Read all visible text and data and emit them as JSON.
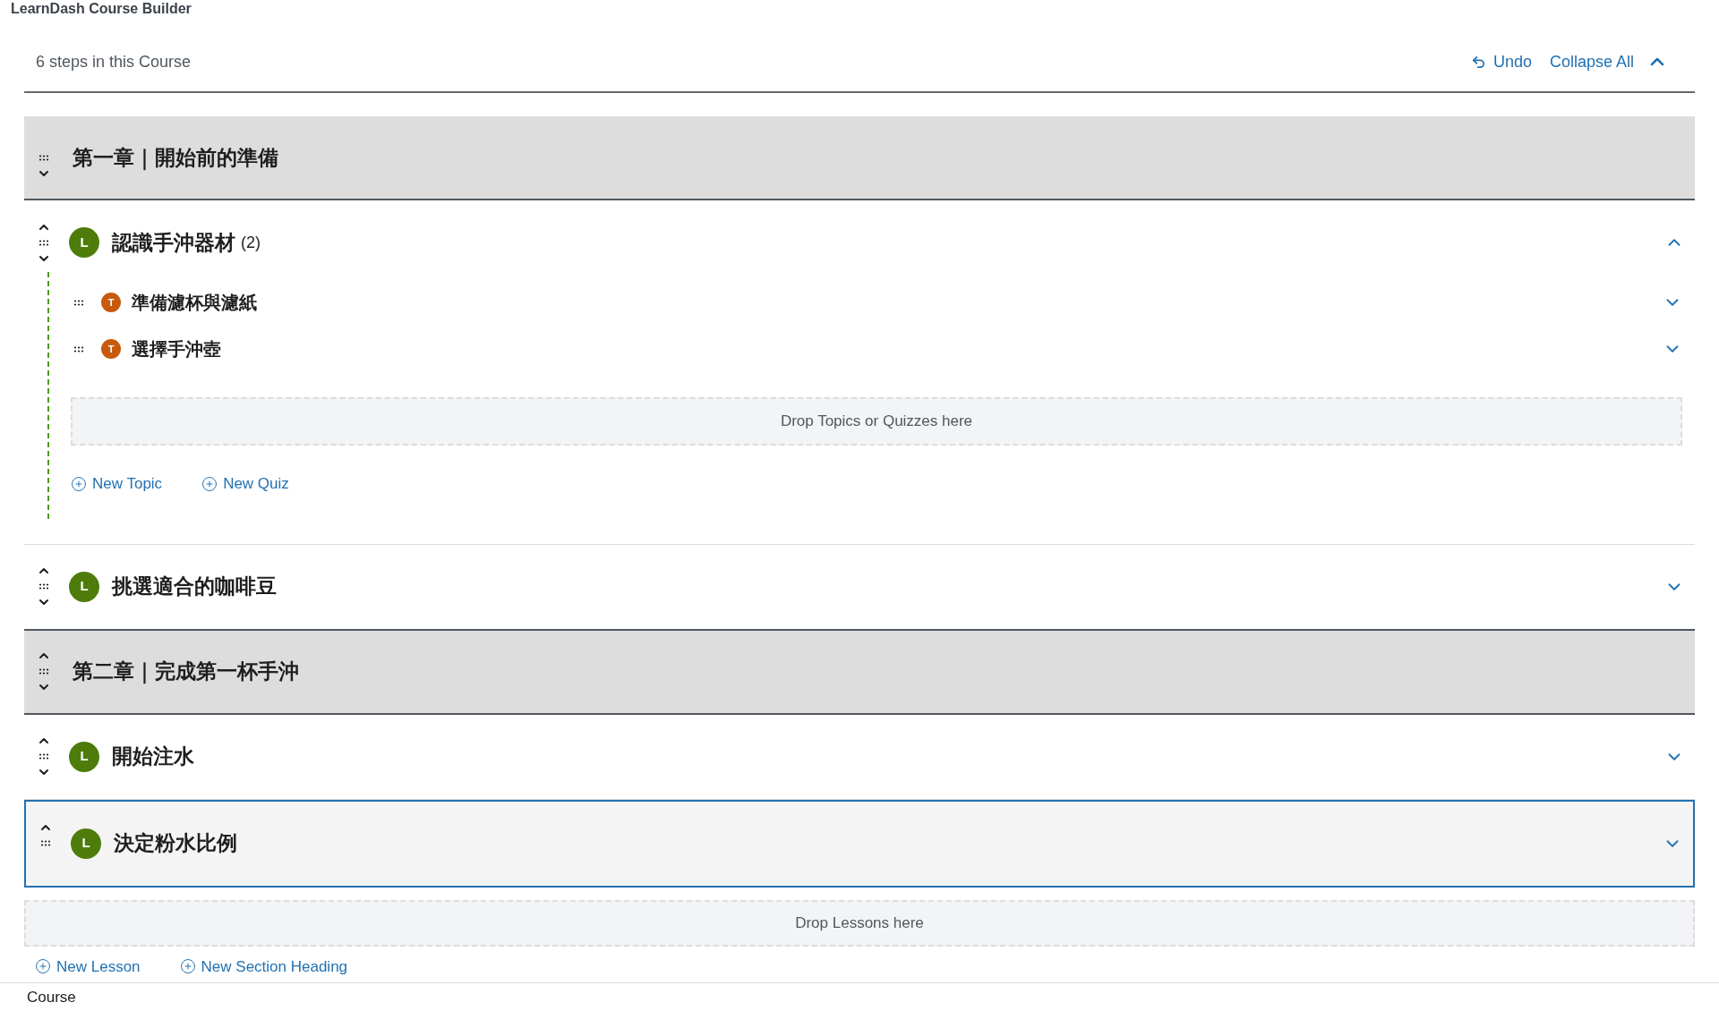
{
  "page_title": "LearnDash Course Builder",
  "steps_label": "6 steps in this Course",
  "toolbar": {
    "undo": "Undo",
    "collapse_all": "Collapse All"
  },
  "items": [
    {
      "kind": "section",
      "title": "第一章｜開始前的準備"
    },
    {
      "kind": "lesson",
      "badge": "L",
      "title": "認識手沖器材",
      "count": "(2)",
      "expanded": true,
      "selected": false,
      "children": [
        {
          "badge": "T",
          "title": "準備濾杯與濾紙",
          "expanded": false
        },
        {
          "badge": "T",
          "title": "選擇手沖壺",
          "expanded": false
        }
      ],
      "drop_hint": "Drop Topics or Quizzes here",
      "actions": [
        "New Topic",
        "New Quiz"
      ]
    },
    {
      "kind": "lesson",
      "badge": "L",
      "title": "挑選適合的咖啡豆",
      "expanded": false,
      "selected": false
    },
    {
      "kind": "section",
      "title": "第二章｜完成第一杯手沖"
    },
    {
      "kind": "lesson",
      "badge": "L",
      "title": "開始注水",
      "expanded": false,
      "selected": false
    },
    {
      "kind": "lesson",
      "badge": "L",
      "title": "決定粉水比例",
      "expanded": false,
      "selected": true
    }
  ],
  "drop_hint": "Drop Lessons here",
  "actions": [
    "New Lesson",
    "New Section Heading"
  ],
  "footer": "Course"
}
